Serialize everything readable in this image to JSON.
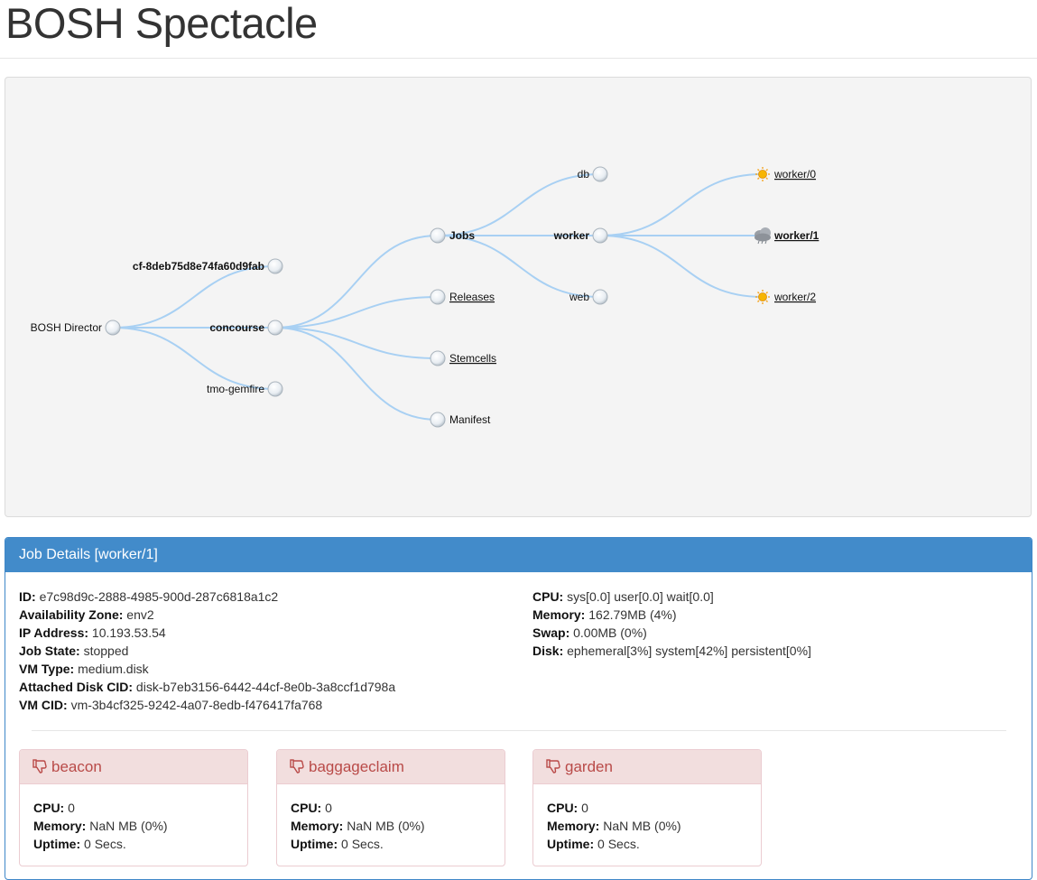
{
  "page": {
    "title": "BOSH Spectacle"
  },
  "tree": {
    "director": "BOSH Director",
    "deployments": [
      "cf-8deb75d8e74fa60d9fab",
      "concourse",
      "tmo-gemfire"
    ],
    "concourse_children": [
      "Jobs",
      "Releases",
      "Stemcells",
      "Manifest"
    ],
    "jobs": [
      "db",
      "worker",
      "web"
    ],
    "instances": [
      {
        "label": "worker/0",
        "status": "sunny-icon"
      },
      {
        "label": "worker/1",
        "status": "storm-cloud-icon"
      },
      {
        "label": "worker/2",
        "status": "sunny-icon"
      }
    ]
  },
  "job_details": {
    "heading": "Job Details [worker/1]",
    "left": [
      {
        "label": "ID:",
        "value": "e7c98d9c-2888-4985-900d-287c6818a1c2"
      },
      {
        "label": "Availability Zone:",
        "value": "env2"
      },
      {
        "label": "IP Address:",
        "value": "10.193.53.54"
      },
      {
        "label": "Job State:",
        "value": "stopped"
      },
      {
        "label": "VM Type:",
        "value": "medium.disk"
      },
      {
        "label": "Attached Disk CID:",
        "value": "disk-b7eb3156-6442-44cf-8e0b-3a8ccf1d798a"
      },
      {
        "label": "VM CID:",
        "value": "vm-3b4cf325-9242-4a07-8edb-f476417fa768"
      }
    ],
    "right": [
      {
        "label": "CPU:",
        "value": "sys[0.0] user[0.0] wait[0.0]"
      },
      {
        "label": "Memory:",
        "value": "162.79MB (4%)"
      },
      {
        "label": "Swap:",
        "value": "0.00MB (0%)"
      },
      {
        "label": "Disk:",
        "value": "ephemeral[3%] system[42%] persistent[0%]"
      }
    ]
  },
  "processes": [
    {
      "name": "beacon",
      "cpu": "0",
      "memory": "NaN MB (0%)",
      "uptime": "0 Secs."
    },
    {
      "name": "baggageclaim",
      "cpu": "0",
      "memory": "NaN MB (0%)",
      "uptime": "0 Secs."
    },
    {
      "name": "garden",
      "cpu": "0",
      "memory": "NaN MB (0%)",
      "uptime": "0 Secs."
    }
  ],
  "process_labels": {
    "cpu": "CPU:",
    "memory": "Memory:",
    "uptime": "Uptime:"
  },
  "colors": {
    "link": "#a8d0f3",
    "panel_primary": "#428bca",
    "danger_text": "#b94a48",
    "danger_bg": "#f2dede"
  }
}
